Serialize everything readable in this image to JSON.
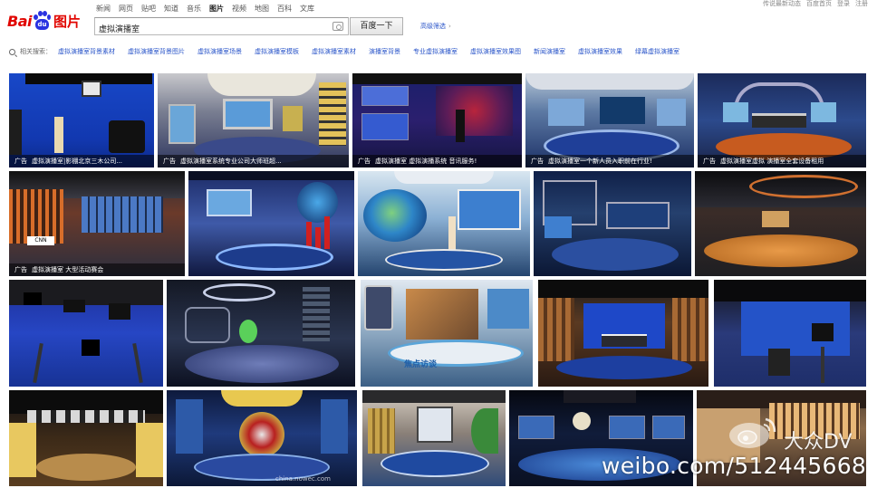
{
  "header": {
    "logo_latin_1": "Bai",
    "logo_paw_text": "du",
    "logo_cn": "图片",
    "nav": [
      {
        "label": "新闻",
        "active": false
      },
      {
        "label": "网页",
        "active": false
      },
      {
        "label": "贴吧",
        "active": false
      },
      {
        "label": "知道",
        "active": false
      },
      {
        "label": "音乐",
        "active": false
      },
      {
        "label": "图片",
        "active": true
      },
      {
        "label": "视频",
        "active": false
      },
      {
        "label": "地图",
        "active": false
      },
      {
        "label": "百科",
        "active": false
      },
      {
        "label": "文库",
        "active": false
      }
    ],
    "top_links": [
      "传说最新动态",
      "百度首页",
      "登录",
      "注册"
    ],
    "search": {
      "query": "虚拟演播室",
      "button_label": "百度一下",
      "filter_label": "高级筛选",
      "filter_chevron": "›"
    }
  },
  "related": {
    "label": "相关搜索：",
    "items": [
      "虚拟演播室背景素材",
      "虚拟演播室背景图片",
      "虚拟演播室场景",
      "虚拟演播室模板",
      "虚拟演播室素材",
      "演播室背景",
      "专业虚拟演播室",
      "虚拟演播室效果图",
      "新闻演播室",
      "虚拟演播室效果",
      "绿幕虚拟演播室"
    ]
  },
  "results": {
    "captions": [
      {
        "ad": "广告",
        "text": "虚拟演播室|影棚北京三木公司..."
      },
      {
        "ad": "广告",
        "text": "虚拟演播室系统专业公司大师班超..."
      },
      {
        "ad": "广告",
        "text": "虚拟演播室 虚拟演播系统 音讯服务!"
      },
      {
        "ad": "广告",
        "text": "虚拟演播室一个新人员入职前在行业!"
      },
      {
        "ad": "广告",
        "text": "虚拟演播室虚拟 演播室全套设备租用"
      },
      {
        "ad": "广告",
        "text": "虚拟演播室 大型活动赛会"
      }
    ],
    "tile_overlay_texts": [
      "焦点访谈",
      "china.nowec.com",
      "CNN"
    ]
  },
  "watermark": {
    "brand": "大众DV",
    "url": "weibo.com/512445668"
  },
  "colors": {
    "logo_red": "#e10601",
    "logo_blue": "#2932e1",
    "link_blue": "#2a55c9"
  }
}
